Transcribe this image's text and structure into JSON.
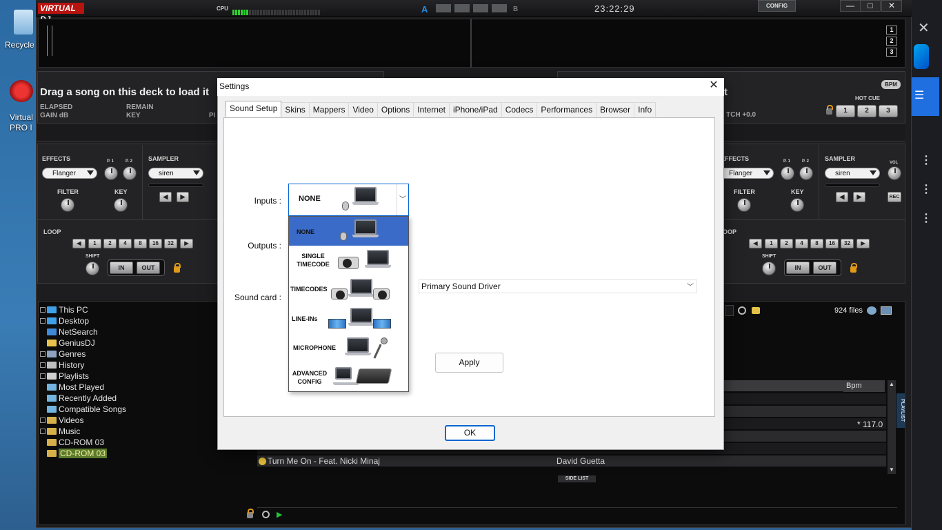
{
  "desktop": {
    "recycle_label": "Recycle",
    "vdj_shortcut_label_1": "Virtual",
    "vdj_shortcut_label_2": "PRO I"
  },
  "app": {
    "logo": "VIRTUAL DJ",
    "cpu_label": "CPU",
    "deck_a_letter": "A",
    "deck_b_letter": "B",
    "clock": "23:22:29",
    "config_label": "CONFIG",
    "zoom_levels": [
      "1",
      "2",
      "3"
    ]
  },
  "deck_left": {
    "title": "Drag a song on this deck to load it",
    "elapsed": "ELAPSED",
    "gain": "GAIN dB",
    "remain": "REMAIN",
    "key": "KEY",
    "pitch_partial": "PI"
  },
  "deck_right": {
    "title_partial": "t",
    "pitch": "TCH +0.0",
    "bpm_badge": "BPM",
    "hot_cue_label": "HOT CUE",
    "hot_cues": [
      "1",
      "2",
      "3"
    ]
  },
  "effects_left": {
    "effects_label": "EFFECTS",
    "effect_value": "Flanger",
    "p1": "P. 1",
    "p2": "P. 2",
    "filter": "FILTER",
    "key": "KEY",
    "sampler_label": "SAMPLER",
    "sampler_value": "siren",
    "loop_label": "LOOP",
    "loop_sizes": [
      "1",
      "2",
      "4",
      "8",
      "16",
      "32"
    ],
    "shift": "SHIFT",
    "in": "IN",
    "out": "OUT"
  },
  "effects_right": {
    "effects_label": "EFFECTS",
    "effect_value": "Flanger",
    "p1": "P. 1",
    "p2": "P. 2",
    "filter": "FILTER",
    "key": "KEY",
    "sampler_label": "SAMPLER",
    "sampler_value": "siren",
    "vol": "VOL",
    "rec": "REC",
    "loop_label": "OOP",
    "loop_sizes": [
      "1",
      "2",
      "4",
      "8",
      "16",
      "32"
    ],
    "shift": "SHIFT",
    "in": "IN",
    "out": "OUT"
  },
  "browser": {
    "tree": [
      {
        "label": "This PC",
        "expand": true
      },
      {
        "label": "Desktop",
        "expand": true
      },
      {
        "label": "NetSearch",
        "expand": false
      },
      {
        "label": "GeniusDJ",
        "expand": false
      },
      {
        "label": "Genres",
        "expand": true
      },
      {
        "label": "History",
        "expand": true
      },
      {
        "label": "Playlists",
        "expand": true
      },
      {
        "label": "Most Played",
        "expand": false
      },
      {
        "label": "Recently Added",
        "expand": false
      },
      {
        "label": "Compatible Songs",
        "expand": false
      },
      {
        "label": "Videos",
        "expand": true
      },
      {
        "label": "Music",
        "expand": true
      },
      {
        "label": "CD-ROM 03",
        "expand": false
      },
      {
        "label": "CD-ROM 03",
        "expand": false
      }
    ],
    "files_count": "924 files",
    "bpm_header": "Bpm",
    "bpm_value": "* 117.0",
    "tracks": [
      {
        "title": "Turn Me On - Feat. Nicki Minaj",
        "artist": "David Guetta"
      }
    ],
    "side_list": "SIDE LIST",
    "playlist_tab": "PLAYLIST"
  },
  "settings": {
    "title": "Settings",
    "tabs": [
      "Sound Setup",
      "Skins",
      "Mappers",
      "Video",
      "Options",
      "Internet",
      "iPhone/iPad",
      "Codecs",
      "Performances",
      "Browser",
      "Info"
    ],
    "active_tab": "Sound Setup",
    "inputs_label": "Inputs :",
    "outputs_label": "Outputs :",
    "soundcard_label": "Sound card :",
    "inputs_selected": "NONE",
    "inputs_options": [
      "NONE",
      "SINGLE TIMECODE",
      "TIMECODES",
      "LINE-INs",
      "MICROPHONE",
      "ADVANCED CONFIG"
    ],
    "soundcard_value": "Primary Sound Driver",
    "apply_label": "Apply",
    "ok_label": "OK"
  }
}
